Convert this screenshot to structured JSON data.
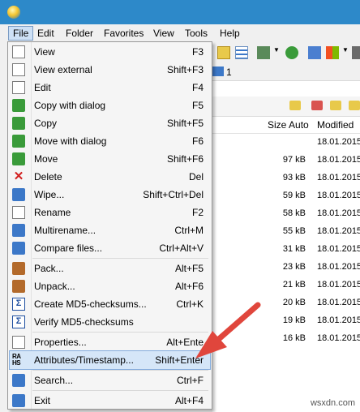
{
  "menubar": {
    "items": [
      "File",
      "Edit",
      "Folder",
      "Favorites",
      "View",
      "Tools",
      "Help"
    ]
  },
  "drivebar": {
    "label": "1"
  },
  "file_list": {
    "headers": {
      "size": "Size Auto",
      "modified": "Modified"
    },
    "rows": [
      {
        "size": "",
        "modified": "18.01.2015"
      },
      {
        "size": "97 kB",
        "modified": "18.01.2015"
      },
      {
        "size": "93 kB",
        "modified": "18.01.2015"
      },
      {
        "size": "59 kB",
        "modified": "18.01.2015"
      },
      {
        "size": "58 kB",
        "modified": "18.01.2015"
      },
      {
        "size": "55 kB",
        "modified": "18.01.2015"
      },
      {
        "size": "31 kB",
        "modified": "18.01.2015"
      },
      {
        "size": "23 kB",
        "modified": "18.01.2015"
      },
      {
        "size": "21 kB",
        "modified": "18.01.2015"
      },
      {
        "size": "20 kB",
        "modified": "18.01.2015"
      },
      {
        "size": "19 kB",
        "modified": "18.01.2015"
      },
      {
        "size": "16 kB",
        "modified": "18.01.2015"
      }
    ]
  },
  "file_menu": {
    "items": [
      {
        "label": "View",
        "shortcut": "F3",
        "icon": "view-icon"
      },
      {
        "label": "View external",
        "shortcut": "Shift+F3",
        "icon": "view-external-icon"
      },
      {
        "label": "Edit",
        "shortcut": "F4",
        "icon": "edit-icon"
      },
      {
        "label": "Copy with dialog",
        "shortcut": "F5",
        "icon": "copy-dialog-icon"
      },
      {
        "label": "Copy",
        "shortcut": "Shift+F5",
        "icon": "copy-icon"
      },
      {
        "label": "Move with dialog",
        "shortcut": "F6",
        "icon": "move-dialog-icon"
      },
      {
        "label": "Move",
        "shortcut": "Shift+F6",
        "icon": "move-icon"
      },
      {
        "label": "Delete",
        "shortcut": "Del",
        "icon": "delete-icon"
      },
      {
        "label": "Wipe...",
        "shortcut": "Shift+Ctrl+Del",
        "icon": "wipe-icon"
      },
      {
        "label": "Rename",
        "shortcut": "F2",
        "icon": "rename-icon"
      },
      {
        "label": "Multirename...",
        "shortcut": "Ctrl+M",
        "icon": "multirename-icon"
      },
      {
        "label": "Compare files...",
        "shortcut": "Ctrl+Alt+V",
        "icon": "compare-icon"
      },
      {
        "label": "Pack...",
        "shortcut": "Alt+F5",
        "icon": "pack-icon"
      },
      {
        "label": "Unpack...",
        "shortcut": "Alt+F6",
        "icon": "unpack-icon"
      },
      {
        "label": "Create MD5-checksums...",
        "shortcut": "Ctrl+K",
        "icon": "md5-create-icon"
      },
      {
        "label": "Verify MD5-checksums",
        "shortcut": "",
        "icon": "md5-verify-icon"
      },
      {
        "label": "Properties...",
        "shortcut": "Alt+Ente",
        "icon": "properties-icon"
      },
      {
        "label": "Attributes/Timestamp...",
        "shortcut": "Shift+Enter",
        "icon": "attributes-icon"
      },
      {
        "label": "Search...",
        "shortcut": "Ctrl+F",
        "icon": "search-icon"
      },
      {
        "label": "Exit",
        "shortcut": "Alt+F4",
        "icon": "exit-icon"
      }
    ],
    "rahs_icon_text": [
      "RA",
      "HS"
    ]
  },
  "watermark": "wsxdn.com",
  "colors": {
    "titlebar": "#2d89c9",
    "highlight": "#d5e6f8",
    "arrow": "#e0463c"
  }
}
